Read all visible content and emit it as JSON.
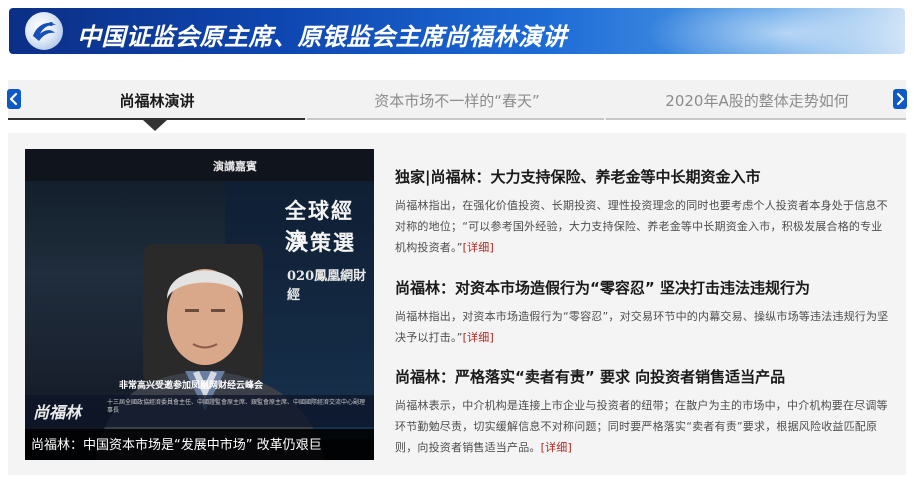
{
  "header": {
    "title": "中国证监会原主席、原银监会主席尚福林演讲",
    "logo_icon": "phoenix-logo-icon"
  },
  "tabs": [
    {
      "label": "尚福林演讲",
      "active": true
    },
    {
      "label": "资本市场不一样的“春天”",
      "active": false
    },
    {
      "label": "2020年A股的整体走势如何",
      "active": false
    }
  ],
  "nav": {
    "prev_icon": "chevron-left-icon",
    "next_icon": "chevron-right-icon"
  },
  "video": {
    "top_label": "演講嘉賓",
    "backdrop_line1": "全球經濟",
    "backdrop_line2": "決策選",
    "backdrop_line3": "020鳳凰網財經",
    "speaker_caption": "非常高兴受邀参加凤凰网财经云峰会",
    "name_big": "尚福林",
    "name_small": "十三屆全國政協經濟委員會主任、中國證監會原主席、銀監會原主席、中國國際經濟交流中心副理事長",
    "caption": "尚福林：中国资本市场是“发展中市场” 改革仍艰巨"
  },
  "articles": [
    {
      "title": "独家|尚福林：大力支持保险、养老金等中长期资金入市",
      "summary": "尚福林指出，在强化价值投资、长期投资、理性投资理念的同时也要考虑个人投资者本身处于信息不对称的地位；“可以参考国外经验，大力支持保险、养老金等中长期资金入市，积极发展合格的专业机构投资者。”",
      "more": "[详细]"
    },
    {
      "title": "尚福林：对资本市场造假行为“零容忍” 坚决打击违法违规行为",
      "summary": "尚福林指出，对资本市场造假行为“零容忍”，对交易环节中的内幕交易、操纵市场等违法违规行为坚决予以打击。”",
      "more": "[详细]"
    },
    {
      "title": "尚福林：严格落实“卖者有责” 要求 向投资者销售适当产品",
      "summary": "尚福林表示，中介机构是连接上市企业与投资者的纽带；在散户为主的市场中，中介机构要在尽调等环节勤勉尽责，切实缓解信息不对称问题；同时要严格落实“卖者有责”要求，根据风险收益匹配原则，向投资者销售适当产品。",
      "more": "[详细]"
    }
  ],
  "colors": {
    "banner_start": "#0b2f86",
    "banner_end": "#cfe3f7",
    "arrow": "#0f59c6",
    "link": "#b3261e",
    "panel": "#f4f4f4"
  }
}
